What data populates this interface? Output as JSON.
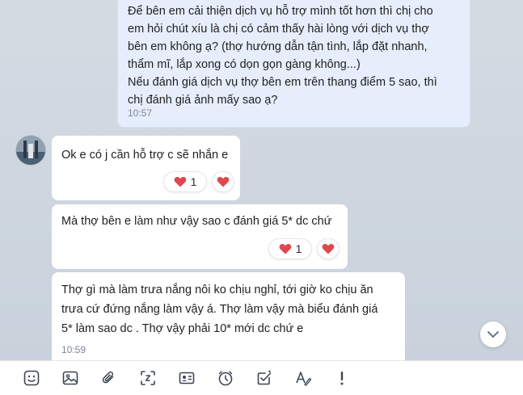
{
  "messages": {
    "outgoing": {
      "text": "Để bên em cải thiện dịch vụ hỗ trợ mình tốt hơn thì chị cho\nem hỏi chút xíu là chị có cảm thấy hài lòng với dịch vụ thợ\nbên em không ạ? (thợ hướng dẫn tận tình, lắp đặt nhanh,\nthẩm mĩ, lắp xong có dọn gọn gàng không...)\nNếu đánh giá dịch vụ thợ bên em trên thang điểm 5 sao, thì\nchị đánh giá ảnh mấy sao ạ?",
      "time": "10:57"
    },
    "incoming": [
      {
        "text": "Ok e có j cần hỗ trợ c sẽ nhắn e",
        "reaction_count": "1"
      },
      {
        "text": "Mà thợ bên e làm như vậy sao c đánh giá 5* dc chứ",
        "reaction_count": "1"
      },
      {
        "text": "Thợ gì mà làm trưa nắng nôi ko chịu nghỉ, tới giờ ko chịu ăn\ntrưa cứ đứng nắng làm vậy á. Thợ làm vậy mà biểu đánh giá\n5* làm sao dc . Thợ vậy phải 10* mới dc chứ e",
        "time": "10:59"
      }
    ]
  },
  "icons": {
    "reaction": "heart-icon",
    "scroll": "chevron-down-icon",
    "toolbar": [
      "sticker-icon",
      "image-icon",
      "attachment-icon",
      "screenshot-icon",
      "contact-card-icon",
      "reminder-clock-icon",
      "task-check-icon",
      "text-format-icon",
      "urgent-icon"
    ]
  },
  "colors": {
    "heart": "#e0484f",
    "outgoing_bubble": "#e6eefb",
    "incoming_bubble": "#ffffff",
    "background": "#d3dbe3"
  }
}
